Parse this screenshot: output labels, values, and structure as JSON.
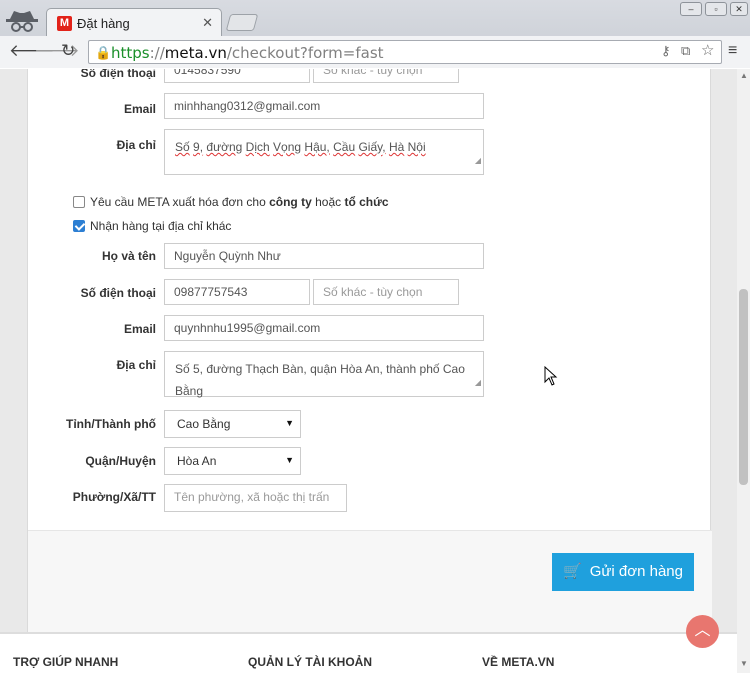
{
  "browser": {
    "tab_title": "Đặt hàng",
    "tab_favicon": "M",
    "url_scheme": "https",
    "url_sep": "://",
    "url_host": "meta.vn",
    "url_path": "/checkout?form=fast"
  },
  "sender": {
    "phone_label": "Số điện thoại",
    "phone_value": "0145837590",
    "phone_alt_placeholder": "Số khác - tùy chọn",
    "email_label": "Email",
    "email_value": "minhhang0312@gmail.com",
    "address_label": "Địa chỉ",
    "address_value": [
      "Số",
      "9,",
      "đường",
      "Dịch",
      "Vọng",
      "Hậu,",
      "Cầu",
      "Giấy,",
      "Hà",
      "Nội"
    ]
  },
  "invoice_checkbox": {
    "checked": false,
    "text_prefix": "Yêu cầu META xuất hóa đơn cho ",
    "bold1": "công ty",
    "middle": " hoặc ",
    "bold2": "tổ chức"
  },
  "other_address_checkbox": {
    "checked": true,
    "label": "Nhận hàng tại địa chỉ khác"
  },
  "recipient": {
    "name_label": "Họ và tên",
    "name_value": "Nguyễn Quỳnh Như",
    "phone_label": "Số điện thoại",
    "phone_value": "09877757543",
    "phone_alt_placeholder": "Số khác - tùy chọn",
    "email_label": "Email",
    "email_value": "quynhnhu1995@gmail.com",
    "address_label": "Địa chỉ",
    "address_line1": "Số 5, đường Thạch Bàn, quận Hòa An, thành phố Cao",
    "address_line2": "Bằng",
    "province_label": "Tỉnh/Thành phố",
    "province_value": "Cao Bằng",
    "district_label": "Quận/Huyện",
    "district_value": "Hòa An",
    "ward_label": "Phường/Xã/TT",
    "ward_placeholder": "Tên phường, xã hoặc thị trấn"
  },
  "submit_label": "Gửi đơn hàng",
  "footer": {
    "col1": "TRỢ GIÚP NHANH",
    "col2": "QUẢN LÝ TÀI KHOẢN",
    "col3": "VỀ META.VN"
  },
  "colors": {
    "accent": "#1fa0dd",
    "to_top": "#e8766f",
    "secure_green": "#1a8f2a"
  }
}
